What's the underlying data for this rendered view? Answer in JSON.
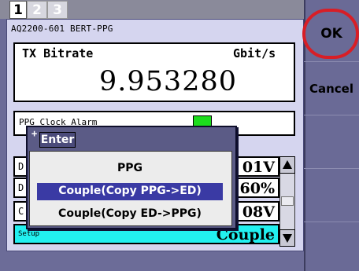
{
  "tabs": [
    "1",
    "2",
    "3"
  ],
  "model_label": "AQ2200-601 BERT-PPG",
  "bitrate": {
    "label": "TX Bitrate",
    "unit": "Gbit/s",
    "value": "9.953280"
  },
  "clock_alarm": {
    "label": "PPG Clock Alarm",
    "led_color": "#1ddc1d"
  },
  "rows": [
    {
      "label": "D",
      "value": "01V"
    },
    {
      "label": "D",
      "value": "60%"
    },
    {
      "label": "C",
      "value": "08V"
    },
    {
      "label": "Setup",
      "value": "Couple",
      "highlight_color": "#22f0f0"
    }
  ],
  "popup": {
    "title": "Enter",
    "options": [
      {
        "label": "PPG",
        "selected": false
      },
      {
        "label": "Couple(Copy PPG->ED)",
        "selected": true
      },
      {
        "label": "Couple(Copy ED->PPG)",
        "selected": false
      }
    ]
  },
  "softkeys": {
    "ok_label": "OK",
    "cancel_label": "Cancel"
  },
  "colors": {
    "panel": "#d5d5ef",
    "selection": "#3a3aa4",
    "highlight_ring": "#d81e26"
  }
}
